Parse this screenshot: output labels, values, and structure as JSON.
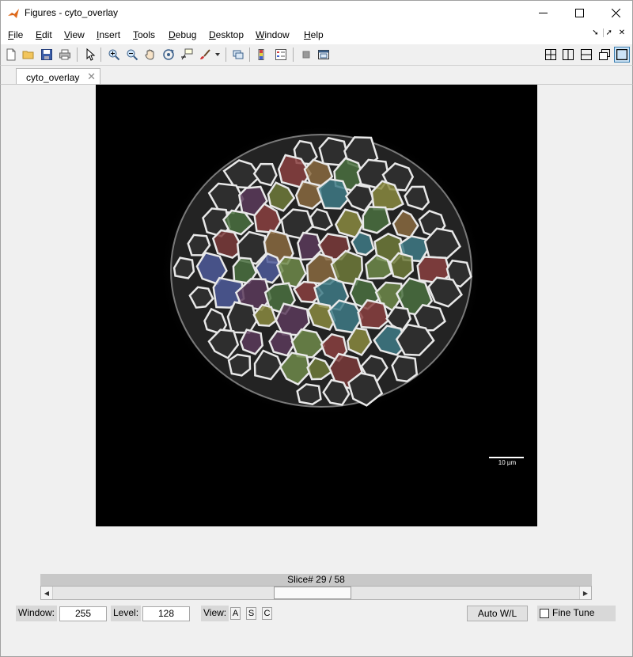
{
  "window": {
    "title": "Figures - cyto_overlay",
    "app_icon": "matlab-icon",
    "controls": {
      "minimize": "—",
      "maximize": "☐",
      "close": "✕"
    }
  },
  "menu": {
    "items": [
      {
        "label": "File",
        "accel": "F",
        "rest": "ile"
      },
      {
        "label": "Edit",
        "accel": "E",
        "rest": "dit"
      },
      {
        "label": "View",
        "accel": "V",
        "rest": "iew"
      },
      {
        "label": "Insert",
        "accel": "I",
        "rest": "nsert"
      },
      {
        "label": "Tools",
        "accel": "T",
        "rest": "ools"
      },
      {
        "label": "Debug",
        "accel": "D",
        "rest": "ebug"
      },
      {
        "label": "Desktop",
        "accel": "D",
        "rest": "esktop"
      },
      {
        "label": "Window",
        "accel": "W",
        "rest": "indow"
      },
      {
        "label": "Help",
        "accel": "H",
        "rest": "elp"
      }
    ],
    "dock_icons": [
      "undock-arrow-icon",
      "pin-icon",
      "close-panel-icon"
    ]
  },
  "toolbar": {
    "icons": [
      "new-figure-icon",
      "open-file-icon",
      "save-icon",
      "print-icon",
      "pointer-icon",
      "zoom-in-icon",
      "zoom-out-icon",
      "pan-icon",
      "rotate-3d-icon",
      "data-cursor-icon",
      "brush-icon",
      "link-plot-icon",
      "colorbar-icon",
      "legend-icon",
      "hide-plot-tools-icon",
      "show-plot-tools-icon"
    ],
    "layout_icons": [
      "tile-grid-icon",
      "tile-columns-icon",
      "tile-rows-icon",
      "float-icon",
      "maximize-icon"
    ]
  },
  "tab": {
    "label": "cyto_overlay",
    "close": "✕"
  },
  "image": {
    "scalebar_label": "10 µm"
  },
  "slice": {
    "label": "Slice# 29 / 58",
    "current": 29,
    "total": 58
  },
  "controls": {
    "window_label": "Window:",
    "window_value": "255",
    "level_label": "Level:",
    "level_value": "128",
    "view_label": "View:",
    "view_buttons": [
      "A",
      "S",
      "C"
    ],
    "auto_wl_label": "Auto W/L",
    "fine_tune_label": "Fine Tune",
    "fine_tune_checked": false
  },
  "colors": {
    "cell_palette": [
      "#8a8a40",
      "#6f8a4a",
      "#4d5a9a",
      "#8a4040",
      "#3e7a86",
      "#6e7a3a",
      "#7a3a3a",
      "#4a7040",
      "#8a6a40",
      "#5a3a5a"
    ]
  }
}
